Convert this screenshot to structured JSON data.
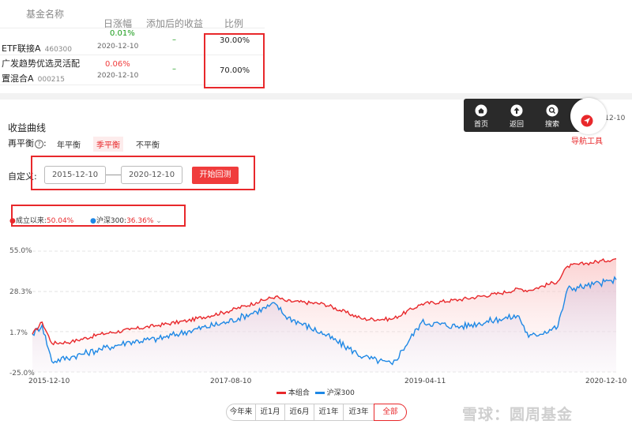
{
  "table": {
    "headers": {
      "name": "基金名称",
      "daily_change": "日涨幅",
      "added_return": "添加后的收益",
      "ratio": "比例"
    },
    "rows": [
      {
        "name": "ETF联接A",
        "code": "460300",
        "change": "0.01%",
        "date": "2020-12-10",
        "added": "–",
        "ratio": "30.00%"
      },
      {
        "name_line1": "广发趋势优选灵活配",
        "name_line2": "置混合A",
        "code": "000215",
        "change": "0.06%",
        "date": "2020-12-10",
        "added": "–",
        "ratio": "70.00%"
      }
    ]
  },
  "curve": {
    "title": "收益曲线",
    "rebalance_label": "再平衡",
    "rebalance_options": [
      "年平衡",
      "季平衡",
      "不平衡"
    ],
    "rebalance_selected": "季平衡",
    "custom_label": "自定义:",
    "start_date": "2015-12-10",
    "end_date": "2020-12-10",
    "start_button": "开始回测",
    "legend_top": [
      {
        "label": "成立以来:",
        "value": "50.04%",
        "color": "#e8282b"
      },
      {
        "label": "沪深300:",
        "value": "36.36%",
        "color": "#1e88e5"
      }
    ],
    "range_buttons": [
      "今年来",
      "近1月",
      "近6月",
      "近1年",
      "近3年",
      "全部"
    ],
    "range_selected": "全部"
  },
  "chart_data": {
    "type": "line",
    "y_ticks": [
      "55.0%",
      "28.3%",
      "1.7%",
      "-25.0%"
    ],
    "ylim": [
      -25.0,
      55.0
    ],
    "x_ticks": [
      "2015-12-10",
      "2017-08-10",
      "2019-04-11",
      "2020-12-10"
    ],
    "series": [
      {
        "name": "本组合",
        "color": "#e8282b",
        "x": [
          "2015-12",
          "2016-01",
          "2016-02",
          "2016-04",
          "2016-07",
          "2016-10",
          "2017-01",
          "2017-04",
          "2017-08",
          "2017-11",
          "2018-01",
          "2018-02",
          "2018-06",
          "2018-10",
          "2019-01",
          "2019-04",
          "2019-08",
          "2019-12",
          "2020-02",
          "2020-03",
          "2020-06",
          "2020-07",
          "2020-09",
          "2020-12"
        ],
        "values": [
          0,
          8,
          -6,
          -5,
          0,
          3,
          6,
          9,
          15,
          21,
          25,
          22,
          20,
          10,
          10,
          20,
          23,
          27,
          30,
          29,
          35,
          45,
          47,
          50
        ]
      },
      {
        "name": "沪深300",
        "color": "#1e88e5",
        "x": [
          "2015-12",
          "2016-01",
          "2016-02",
          "2016-04",
          "2016-07",
          "2016-10",
          "2017-01",
          "2017-04",
          "2017-08",
          "2017-11",
          "2018-01",
          "2018-02",
          "2018-06",
          "2018-10",
          "2019-01",
          "2019-04",
          "2019-08",
          "2019-12",
          "2020-02",
          "2020-03",
          "2020-06",
          "2020-07",
          "2020-09",
          "2020-12"
        ],
        "values": [
          0,
          6,
          -18,
          -15,
          -10,
          -5,
          -3,
          2,
          8,
          15,
          20,
          12,
          0,
          -15,
          -20,
          8,
          5,
          10,
          12,
          -2,
          5,
          30,
          32,
          36
        ]
      }
    ]
  },
  "nav": {
    "items": [
      "首页",
      "返回",
      "搜索"
    ],
    "date_partial": "-12-10",
    "tool_label": "导航工具"
  },
  "watermark": {
    "text": "雪球：圆周基金"
  }
}
